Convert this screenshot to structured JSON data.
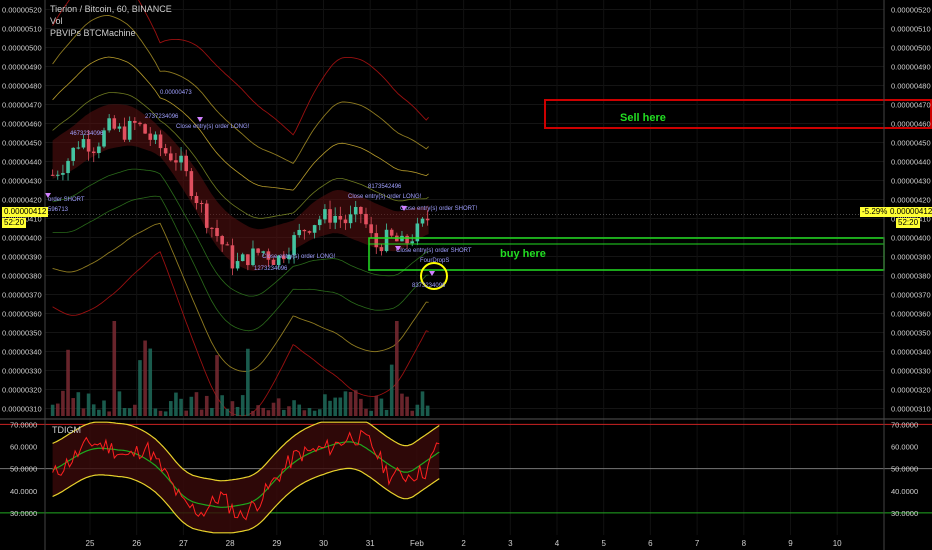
{
  "header": {
    "symbol_line": "Tierion / Bitcoin, 60, BINANCE",
    "indicator_vol": "Vol",
    "indicator_bb": "PBVIPs BTCMachine",
    "oscillator_name": "TDIGM"
  },
  "price_axis": {
    "labels": [
      "0.00000520",
      "0.00000510",
      "0.00000500",
      "0.00000490",
      "0.00000480",
      "0.00000470",
      "0.00000460",
      "0.00000450",
      "0.00000440",
      "0.00000430",
      "0.00000420",
      "0.00000410",
      "0.00000400",
      "0.00000390",
      "0.00000380",
      "0.00000370",
      "0.00000360",
      "0.00000350",
      "0.00000340",
      "0.00000330",
      "0.00000320",
      "0.00000310"
    ],
    "last_price": "0.00000412",
    "countdown": "52:20",
    "change": "-5.29%"
  },
  "osc_axis": {
    "labels": [
      "70.0000",
      "60.0000",
      "50.0000",
      "40.0000",
      "30.0000"
    ]
  },
  "time_axis": {
    "labels": [
      "25",
      "26",
      "27",
      "28",
      "29",
      "30",
      "31",
      "Feb",
      "2",
      "3",
      "4",
      "5",
      "6",
      "7",
      "8",
      "9",
      "10"
    ]
  },
  "annotations": {
    "sell": "Sell here",
    "buy": "buy here",
    "marker_texts": [
      "0.00000473",
      "2737234096",
      "Close entry(s) order LONG!",
      "order SHORT",
      "596713",
      "4673234096",
      "1273234096",
      "Close entry(s) order LONG!",
      "8173542496",
      "Close entry(s) order LONG!",
      "Close entry(s) order SHORT",
      "FourDropS",
      "Close entry(s) order SHORT!",
      "8373234096"
    ]
  },
  "colors": {
    "background": "#000000",
    "sell_box": "#cc0000",
    "buy_box": "#22dd22",
    "sell_text": "#22dd22",
    "buy_text": "#22dd22",
    "up_candle": "#44c4a1",
    "down_candle": "#e0505f",
    "price_tag": "#ffff33",
    "circle": "#ffff00",
    "rsi_line": "#ff2020",
    "band_line": "#e8d22c",
    "signal_line": "#1eaa1e"
  },
  "chart_data": {
    "type": "line",
    "title": "Tierion / Bitcoin, 60, BINANCE",
    "x": [
      "25",
      "26",
      "27",
      "28",
      "29",
      "30",
      "31",
      "Feb",
      "2",
      "3",
      "4",
      "5",
      "6",
      "7",
      "8",
      "9",
      "10"
    ],
    "price_range": [
      3.05e-06,
      5.25e-06
    ],
    "oscillator_range": [
      20,
      72
    ],
    "series": [
      {
        "name": "Tierion / Bitcoin",
        "x": [
          24.2,
          24.5,
          24.8,
          25.1,
          25.4,
          25.7,
          26.0,
          26.3,
          26.6,
          26.9,
          27.2,
          27.5,
          27.8,
          28.1,
          28.4,
          28.7,
          29.0,
          29.3,
          29.6,
          29.9,
          30.2,
          30.5,
          30.8,
          31.1,
          31.4,
          31.7,
          32.0,
          32.3
        ],
        "values": [
          4.33e-06,
          4.4e-06,
          4.52e-06,
          4.48e-06,
          4.58e-06,
          4.55e-06,
          4.6e-06,
          4.52e-06,
          4.45e-06,
          4.41e-06,
          4.25e-06,
          4.1e-06,
          3.98e-06,
          3.85e-06,
          3.9e-06,
          3.93e-06,
          3.88e-06,
          3.97e-06,
          4.05e-06,
          4.1e-06,
          4.12e-06,
          4.08e-06,
          4.13e-06,
          3.95e-06,
          4e-06,
          3.96e-06,
          4.03e-06,
          4.12e-06
        ]
      },
      {
        "name": "TDIGM",
        "x": [
          24.2,
          24.6,
          25.0,
          25.4,
          25.8,
          26.2,
          26.6,
          27.0,
          27.4,
          27.8,
          28.2,
          28.6,
          29.0,
          29.4,
          29.8,
          30.2,
          30.6,
          31.0,
          31.4,
          31.8,
          32.2,
          32.5
        ],
        "values": [
          47,
          54,
          62,
          60,
          55,
          60,
          48,
          34,
          30,
          38,
          28,
          35,
          46,
          56,
          58,
          60,
          65,
          62,
          47,
          47,
          49,
          63
        ]
      }
    ],
    "levels": [
      70,
      50,
      30
    ]
  }
}
